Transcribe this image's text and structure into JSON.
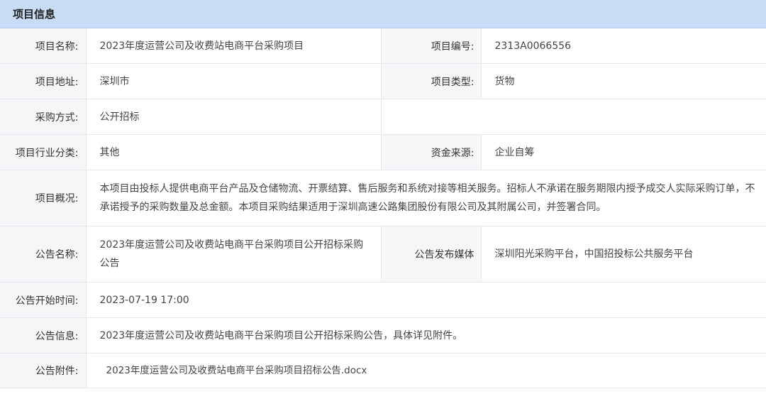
{
  "section": {
    "title": "项目信息"
  },
  "rows": {
    "project_name": {
      "label": "项目名称:",
      "value": "2023年度运营公司及收费站电商平台采购项目"
    },
    "project_number": {
      "label": "项目编号:",
      "value": "2313A0066556"
    },
    "project_address": {
      "label": "项目地址:",
      "value": "深圳市"
    },
    "project_type": {
      "label": "项目类型:",
      "value": "货物"
    },
    "procurement_method": {
      "label": "采购方式:",
      "value": "公开招标"
    },
    "industry": {
      "label": "项目行业分类:",
      "value": "其他"
    },
    "funding_source": {
      "label": "资金来源:",
      "value": "企业自筹"
    },
    "overview": {
      "label": "项目概况:",
      "value": "本项目由投标人提供电商平台产品及仓储物流、开票结算、售后服务和系统对接等相关服务。招标人不承诺在服务期限内授予成交人实际采购订单，不承诺授予的采购数量及总金额。本项目采购结果适用于深圳高速公路集团股份有限公司及其附属公司，并签署合同。"
    },
    "notice_name": {
      "label": "公告名称:",
      "value": "2023年度运营公司及收费站电商平台采购项目公开招标采购公告"
    },
    "notice_media": {
      "label": "公告发布媒体",
      "value": "深圳阳光采购平台，中国招投标公共服务平台"
    },
    "notice_start": {
      "label": "公告开始时间:",
      "value": "2023-07-19 17:00"
    },
    "notice_info": {
      "label": "公告信息:",
      "value": "2023年度运营公司及收费站电商平台采购项目公开招标采购公告，具体详见附件。"
    },
    "attachment": {
      "label": "公告附件:",
      "value": "2023年度运营公司及收费站电商平台采购项目招标公告.docx"
    }
  }
}
